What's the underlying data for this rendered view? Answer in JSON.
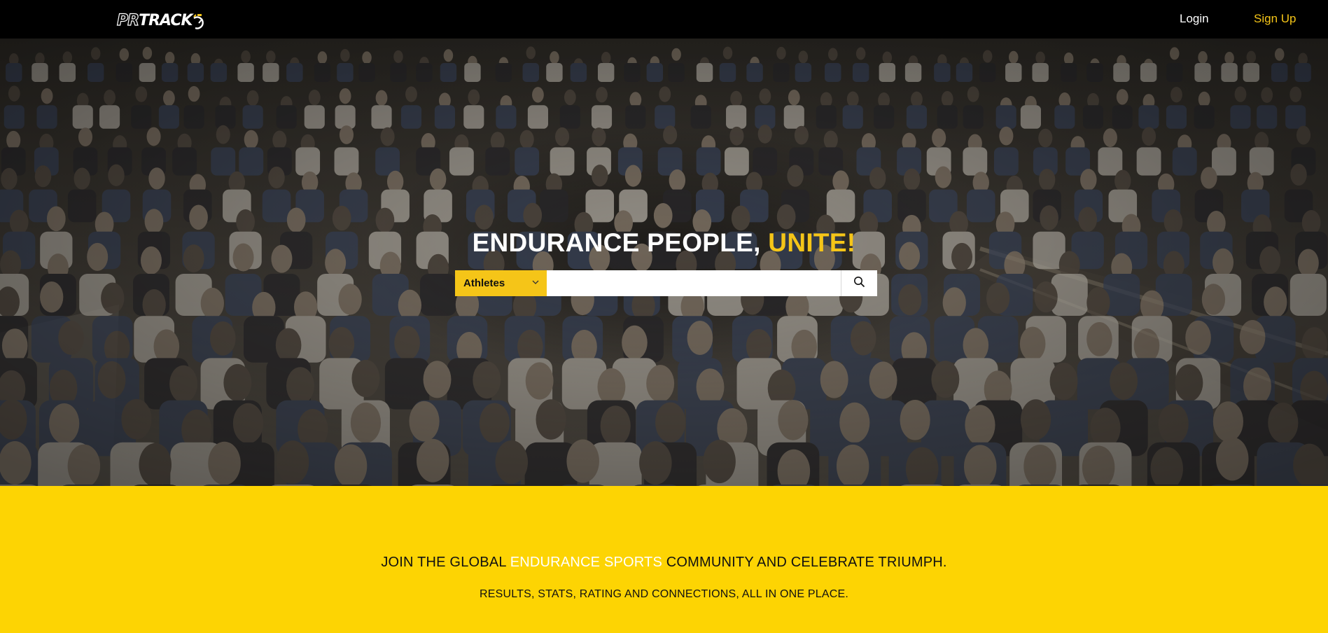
{
  "header": {
    "logo_outline": "PR",
    "logo_solid": "TRACK",
    "login_label": "Login",
    "signup_label": "Sign Up"
  },
  "hero": {
    "title_main": "ENDURANCE PEOPLE, ",
    "title_accent": "UNITE!",
    "search": {
      "category_selected": "Athletes",
      "input_value": "",
      "input_placeholder": ""
    },
    "icons": {
      "dropdown": "chevron-down-icon",
      "search": "search-icon"
    }
  },
  "band": {
    "line1_before": "JOIN THE GLOBAL ",
    "line1_highlight": "ENDURANCE SPORTS",
    "line1_after": " COMMUNITY AND CELEBRATE TRIUMPH.",
    "line2": "RESULTS, STATS, RATING AND CONNECTIONS, ALL IN ONE PLACE."
  },
  "colors": {
    "accent": "#f5c518",
    "band": "#fdd403",
    "header_bg": "#000000"
  }
}
